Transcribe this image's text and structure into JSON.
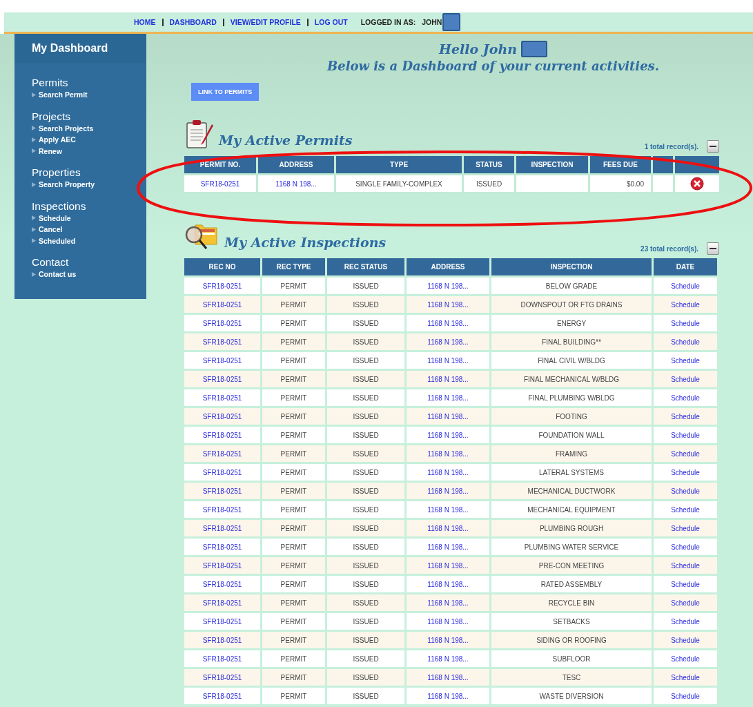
{
  "top_nav": {
    "links": [
      "HOME",
      "DASHBOARD",
      "VIEW/EDIT PROFILE",
      "LOG OUT"
    ],
    "logged_in_label": "LOGGED IN AS:",
    "user": "JOHN"
  },
  "sidebar": {
    "title": "My Dashboard",
    "sections": [
      {
        "heading": "Permits",
        "items": [
          "Search Permit"
        ]
      },
      {
        "heading": "Projects",
        "items": [
          "Search Projects",
          "Apply AEC",
          "Renew"
        ]
      },
      {
        "heading": "Properties",
        "items": [
          "Search Property"
        ]
      },
      {
        "heading": "Inspections",
        "items": [
          "Schedule",
          "Cancel",
          "Scheduled"
        ]
      },
      {
        "heading": "Contact",
        "items": [
          "Contact us"
        ]
      }
    ]
  },
  "greeting": {
    "hello": "Hello John",
    "subtitle": "Below is a Dashboard of your current activities."
  },
  "link_button": "LINK TO PERMITS",
  "permits": {
    "title": "My Active Permits",
    "record_count": "1 total record(s).",
    "columns": [
      "PERMIT NO.",
      "ADDRESS",
      "TYPE",
      "STATUS",
      "INSPECTION",
      "FEES DUE",
      "",
      ""
    ],
    "rows": [
      {
        "permit_no": "SFR18-0251",
        "address": "1168 N 198...",
        "type": "SINGLE FAMILY-COMPLEX",
        "status": "ISSUED",
        "fees_due": "$0.00"
      }
    ]
  },
  "inspections": {
    "title": "My Active Inspections",
    "record_count": "23 total record(s).",
    "columns": [
      "REC NO",
      "REC TYPE",
      "REC STATUS",
      "ADDRESS",
      "INSPECTION",
      "DATE"
    ],
    "rows": [
      {
        "rec_no": "SFR18-0251",
        "rec_type": "PERMIT",
        "rec_status": "ISSUED",
        "address": "1168 N 198...",
        "inspection": "BELOW GRADE",
        "date": "Schedule"
      },
      {
        "rec_no": "SFR18-0251",
        "rec_type": "PERMIT",
        "rec_status": "ISSUED",
        "address": "1168 N 198...",
        "inspection": "DOWNSPOUT OR FTG DRAINS",
        "date": "Schedule"
      },
      {
        "rec_no": "SFR18-0251",
        "rec_type": "PERMIT",
        "rec_status": "ISSUED",
        "address": "1168 N 198...",
        "inspection": "ENERGY",
        "date": "Schedule"
      },
      {
        "rec_no": "SFR18-0251",
        "rec_type": "PERMIT",
        "rec_status": "ISSUED",
        "address": "1168 N 198...",
        "inspection": "FINAL BUILDING**",
        "date": "Schedule"
      },
      {
        "rec_no": "SFR18-0251",
        "rec_type": "PERMIT",
        "rec_status": "ISSUED",
        "address": "1168 N 198...",
        "inspection": "FINAL CIVIL W/BLDG",
        "date": "Schedule"
      },
      {
        "rec_no": "SFR18-0251",
        "rec_type": "PERMIT",
        "rec_status": "ISSUED",
        "address": "1168 N 198...",
        "inspection": "FINAL MECHANICAL W/BLDG",
        "date": "Schedule"
      },
      {
        "rec_no": "SFR18-0251",
        "rec_type": "PERMIT",
        "rec_status": "ISSUED",
        "address": "1168 N 198...",
        "inspection": "FINAL PLUMBING W/BLDG",
        "date": "Schedule"
      },
      {
        "rec_no": "SFR18-0251",
        "rec_type": "PERMIT",
        "rec_status": "ISSUED",
        "address": "1168 N 198...",
        "inspection": "FOOTING",
        "date": "Schedule"
      },
      {
        "rec_no": "SFR18-0251",
        "rec_type": "PERMIT",
        "rec_status": "ISSUED",
        "address": "1168 N 198...",
        "inspection": "FOUNDATION WALL",
        "date": "Schedule"
      },
      {
        "rec_no": "SFR18-0251",
        "rec_type": "PERMIT",
        "rec_status": "ISSUED",
        "address": "1168 N 198...",
        "inspection": "FRAMING",
        "date": "Schedule"
      },
      {
        "rec_no": "SFR18-0251",
        "rec_type": "PERMIT",
        "rec_status": "ISSUED",
        "address": "1168 N 198...",
        "inspection": "LATERAL SYSTEMS",
        "date": "Schedule"
      },
      {
        "rec_no": "SFR18-0251",
        "rec_type": "PERMIT",
        "rec_status": "ISSUED",
        "address": "1168 N 198...",
        "inspection": "MECHANICAL DUCTWORK",
        "date": "Schedule"
      },
      {
        "rec_no": "SFR18-0251",
        "rec_type": "PERMIT",
        "rec_status": "ISSUED",
        "address": "1168 N 198...",
        "inspection": "MECHANICAL EQUIPMENT",
        "date": "Schedule"
      },
      {
        "rec_no": "SFR18-0251",
        "rec_type": "PERMIT",
        "rec_status": "ISSUED",
        "address": "1168 N 198...",
        "inspection": "PLUMBING ROUGH",
        "date": "Schedule"
      },
      {
        "rec_no": "SFR18-0251",
        "rec_type": "PERMIT",
        "rec_status": "ISSUED",
        "address": "1168 N 198...",
        "inspection": "PLUMBING WATER SERVICE",
        "date": "Schedule"
      },
      {
        "rec_no": "SFR18-0251",
        "rec_type": "PERMIT",
        "rec_status": "ISSUED",
        "address": "1168 N 198...",
        "inspection": "PRE-CON MEETING",
        "date": "Schedule"
      },
      {
        "rec_no": "SFR18-0251",
        "rec_type": "PERMIT",
        "rec_status": "ISSUED",
        "address": "1168 N 198...",
        "inspection": "RATED ASSEMBLY",
        "date": "Schedule"
      },
      {
        "rec_no": "SFR18-0251",
        "rec_type": "PERMIT",
        "rec_status": "ISSUED",
        "address": "1168 N 198...",
        "inspection": "RECYCLE BIN",
        "date": "Schedule"
      },
      {
        "rec_no": "SFR18-0251",
        "rec_type": "PERMIT",
        "rec_status": "ISSUED",
        "address": "1168 N 198...",
        "inspection": "SETBACKS",
        "date": "Schedule"
      },
      {
        "rec_no": "SFR18-0251",
        "rec_type": "PERMIT",
        "rec_status": "ISSUED",
        "address": "1168 N 198...",
        "inspection": "SIDING OR ROOFING",
        "date": "Schedule"
      },
      {
        "rec_no": "SFR18-0251",
        "rec_type": "PERMIT",
        "rec_status": "ISSUED",
        "address": "1168 N 198...",
        "inspection": "SUBFLOOR",
        "date": "Schedule"
      },
      {
        "rec_no": "SFR18-0251",
        "rec_type": "PERMIT",
        "rec_status": "ISSUED",
        "address": "1168 N 198...",
        "inspection": "TESC",
        "date": "Schedule"
      },
      {
        "rec_no": "SFR18-0251",
        "rec_type": "PERMIT",
        "rec_status": "ISSUED",
        "address": "1168 N 198...",
        "inspection": "WASTE DIVERSION",
        "date": "Schedule"
      }
    ]
  }
}
